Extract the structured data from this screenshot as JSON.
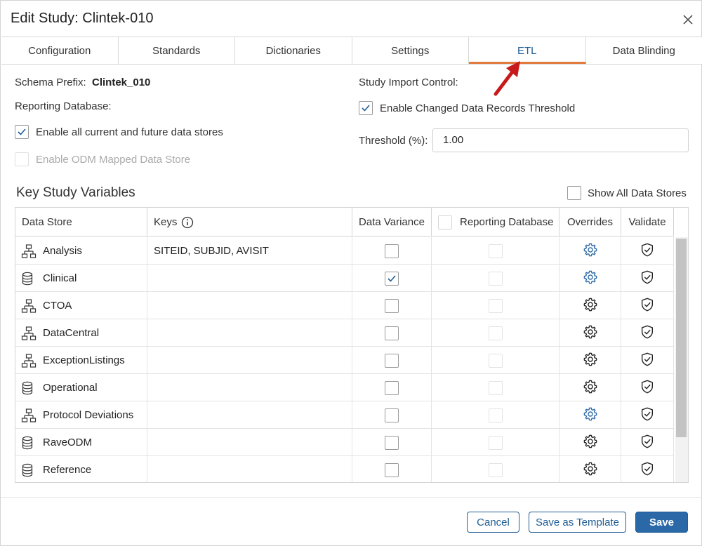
{
  "dialog": {
    "title": "Edit Study: Clintek-010"
  },
  "tabs": [
    {
      "label": "Configuration",
      "active": false
    },
    {
      "label": "Standards",
      "active": false
    },
    {
      "label": "Dictionaries",
      "active": false
    },
    {
      "label": "Settings",
      "active": false
    },
    {
      "label": "ETL",
      "active": true
    },
    {
      "label": "Data Blinding",
      "active": false
    }
  ],
  "form": {
    "schema_prefix_label": "Schema Prefix:",
    "schema_prefix_value": "Clintek_010",
    "reporting_db_label": "Reporting Database:",
    "enable_all_label": "Enable all current and future data stores",
    "enable_all_checked": true,
    "enable_odm_label": "Enable ODM Mapped Data Store",
    "enable_odm_checked": false,
    "study_import_label": "Study Import Control:",
    "enable_threshold_label": "Enable Changed Data Records Threshold",
    "enable_threshold_checked": true,
    "threshold_label": "Threshold (%):",
    "threshold_value": "1.00"
  },
  "key_vars": {
    "title": "Key Study Variables",
    "show_all_label": "Show All Data Stores",
    "show_all_checked": false,
    "columns": {
      "data_store": "Data Store",
      "keys": "Keys",
      "data_variance": "Data Variance",
      "reporting_db": "Reporting Database",
      "overrides": "Overrides",
      "validate": "Validate"
    },
    "rows": [
      {
        "name": "Analysis",
        "icon": "hierarchy-icon",
        "keys": "SITEID, SUBJID, AVISIT",
        "variance": false,
        "override_active": true
      },
      {
        "name": "Clinical",
        "icon": "database-icon",
        "keys": "",
        "variance": true,
        "override_active": true
      },
      {
        "name": "CTOA",
        "icon": "hierarchy-icon",
        "keys": "",
        "variance": false,
        "override_active": false
      },
      {
        "name": "DataCentral",
        "icon": "hierarchy-icon",
        "keys": "",
        "variance": false,
        "override_active": false
      },
      {
        "name": "ExceptionListings",
        "icon": "hierarchy-icon",
        "keys": "",
        "variance": false,
        "override_active": false
      },
      {
        "name": "Operational",
        "icon": "database-icon",
        "keys": "",
        "variance": false,
        "override_active": false
      },
      {
        "name": "Protocol Deviations",
        "icon": "hierarchy-icon",
        "keys": "",
        "variance": false,
        "override_active": true
      },
      {
        "name": "RaveODM",
        "icon": "database-icon",
        "keys": "",
        "variance": false,
        "override_active": false
      },
      {
        "name": "Reference",
        "icon": "database-icon",
        "keys": "",
        "variance": false,
        "override_active": false
      }
    ]
  },
  "buttons": {
    "cancel": "Cancel",
    "save_template": "Save as Template",
    "save": "Save"
  },
  "colors": {
    "accent_blue": "#2a68a8",
    "tab_underline": "#e27a3f",
    "annotation_arrow": "#c81a1a"
  }
}
